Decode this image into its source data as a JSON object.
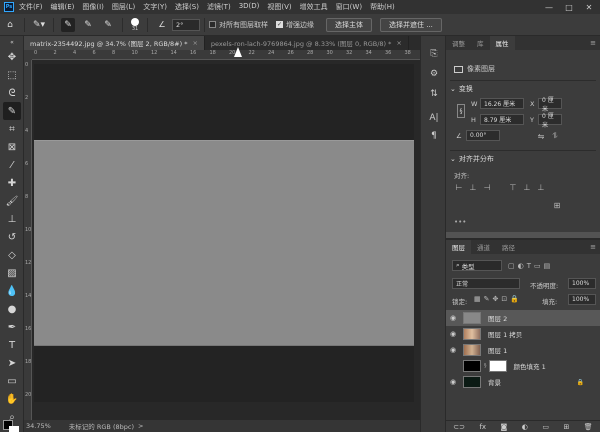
{
  "app": {
    "logo": "Ps"
  },
  "menu": [
    "文件(F)",
    "编辑(E)",
    "图像(I)",
    "图层(L)",
    "文字(Y)",
    "选择(S)",
    "滤镜(T)",
    "3D(D)",
    "视图(V)",
    "增效工具",
    "窗口(W)",
    "帮助(H)"
  ],
  "window_controls": {
    "minimize": "—",
    "maximize": "□",
    "close": "✕"
  },
  "options": {
    "brush_size": "31",
    "angle": "2°",
    "sample_all_layers": "对所有图层取样",
    "enhance_edge": "增强边缘",
    "select_subject": "选择主体",
    "select_and_mask": "选择并遮住 ..."
  },
  "tabs": [
    {
      "label": "matrix-2354492.jpg @ 34.7% (图层 2, RGB/8#) *",
      "close": "×",
      "active": true
    },
    {
      "label": "pexels-ron-lach-9769864.jpg @ 8.33% (图层 0, RGB/8) *",
      "close": "×",
      "active": false
    }
  ],
  "ruler_top": [
    "0",
    "2",
    "4",
    "6",
    "8",
    "10",
    "12",
    "14",
    "16",
    "18",
    "20",
    "22",
    "24",
    "26",
    "28",
    "30",
    "32",
    "34",
    "36",
    "38"
  ],
  "ruler_left": [
    "0",
    "2",
    "4",
    "6",
    "8",
    "10",
    "12",
    "14",
    "16",
    "18",
    "20"
  ],
  "status": {
    "zoom": "34.75%",
    "info": "未标记的 RGB (8bpc)",
    "arrow": ">"
  },
  "properties": {
    "tabs": [
      "调整",
      "库",
      "属性"
    ],
    "kind_label": "像素图层",
    "transform": {
      "title": "变换",
      "w_label": "W",
      "w_value": "16.26 厘米",
      "x_label": "X",
      "x_value": "0 厘米",
      "h_label": "H",
      "h_value": "8.79 厘米",
      "y_label": "Y",
      "y_value": "0 厘米",
      "angle_value": "0.00°"
    },
    "align": {
      "title": "对齐并分布",
      "sub": "对齐:"
    }
  },
  "layers": {
    "tabs": [
      "图层",
      "通道",
      "路径"
    ],
    "filter_kind": "类型",
    "blend_mode": "正常",
    "opacity_label": "不透明度:",
    "opacity_value": "100%",
    "lock_label": "锁定:",
    "fill_label": "填充:",
    "fill_value": "100%",
    "items": [
      {
        "name": "图层 2",
        "visible": true,
        "selected": true
      },
      {
        "name": "图层 1 拷贝",
        "visible": true,
        "selected": false
      },
      {
        "name": "图层 1",
        "visible": true,
        "selected": false
      },
      {
        "name": "颜色填充 1",
        "visible": false,
        "selected": false
      },
      {
        "name": "背景",
        "visible": true,
        "selected": false
      }
    ]
  },
  "colors": {
    "canvas_gray": "#8a8a8a",
    "panel": "#3c3c3c",
    "accent": "#31a8ff"
  }
}
